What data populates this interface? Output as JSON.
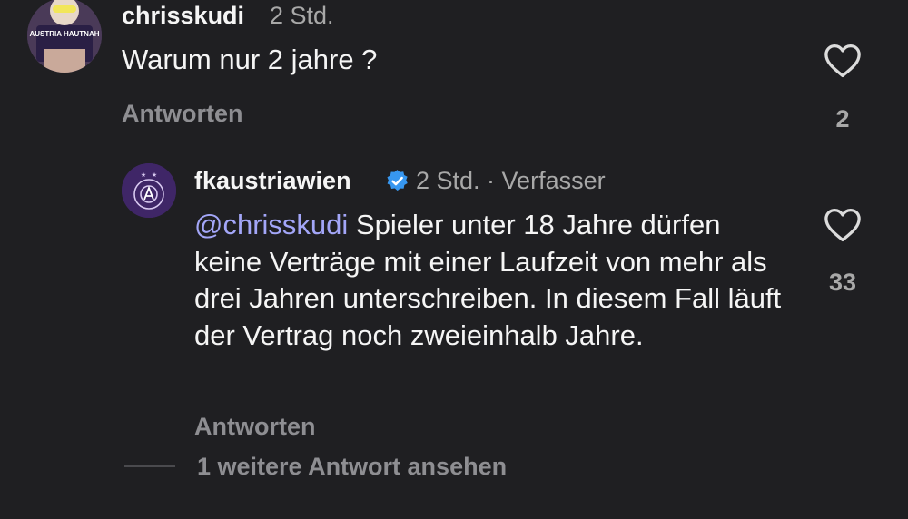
{
  "comment": {
    "username": "chrisskudi",
    "time": "2 Std.",
    "text": "Warum nur 2 jahre ?",
    "reply_label": "Antworten",
    "likes": "2",
    "avatar_text": "AUSTRIA HAUTNAH"
  },
  "reply": {
    "username": "fkaustriawien",
    "meta": "2 Std. · Verfasser",
    "mention": "@chrisskudi",
    "text": "Spieler unter 18 Jahre dürfen keine Verträge mit einer Laufzeit von mehr als drei Jahren unterschreiben. In diesem Fall läuft der Vertrag noch zweieinhalb Jahre.",
    "reply_label": "Antworten",
    "likes": "33",
    "verified_icon": "verified-badge-icon"
  },
  "view_more": "1 weitere Antwort ansehen",
  "colors": {
    "background": "#1f1f22",
    "mention": "#a3a6f8",
    "verified": "#3797f0",
    "club_purple": "#3f2667"
  }
}
